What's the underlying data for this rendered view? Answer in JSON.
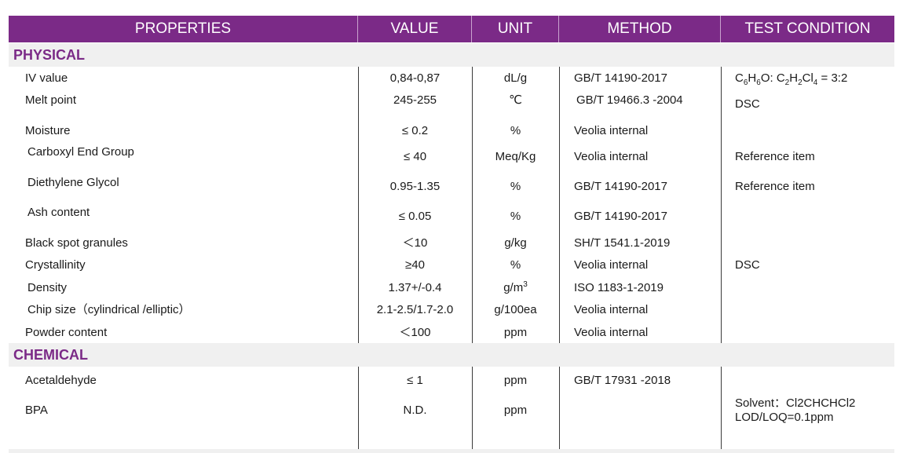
{
  "header": {
    "properties": "PROPERTIES",
    "value": "VALUE",
    "unit": "UNIT",
    "method": "METHOD",
    "test_condition": "TEST CONDITION"
  },
  "sections": {
    "physical": "PHYSICAL",
    "chemical": "CHEMICAL"
  },
  "rows": [
    {
      "property": "IV value",
      "value": "0,84-0,87",
      "unit": "dL/g",
      "method": "GB/T 14190-2017",
      "condition": "C6H6O: C2H2Cl4 = 3:2"
    },
    {
      "property": "Melt point",
      "value": "245-255",
      "unit": "℃",
      "method": "GB/T 19466.3 -2004",
      "condition": "DSC"
    },
    {
      "property": "Moisture",
      "value": "≤ 0.2",
      "unit": "%",
      "method": "Veolia internal",
      "condition": ""
    },
    {
      "property": "Carboxyl End Group",
      "value": "≤ 40",
      "unit": "Meq/Kg",
      "method": "Veolia internal",
      "condition": "Reference item"
    },
    {
      "property": "Diethylene Glycol",
      "value": "0.95-1.35",
      "unit": "%",
      "method": "GB/T 14190-2017",
      "condition": "Reference item"
    },
    {
      "property": "Ash content",
      "value": "≤ 0.05",
      "unit": "%",
      "method": "GB/T 14190-2017",
      "condition": ""
    },
    {
      "property": "Black spot granules",
      "value": "＜10",
      "unit": "g/kg",
      "method": "SH/T 1541.1-2019",
      "condition": ""
    },
    {
      "property": "Crystallinity",
      "value": "≥40",
      "unit": "%",
      "method": "Veolia internal",
      "condition": "DSC"
    },
    {
      "property": "Density",
      "value": "1.37+/-0.4",
      "unit": "g/m3",
      "method": "ISO 1183-1-2019",
      "condition": ""
    },
    {
      "property": "Chip size（cylindrical /elliptic）",
      "value": "2.1-2.5/1.7-2.0",
      "unit": "g/100ea",
      "method": "Veolia internal",
      "condition": ""
    },
    {
      "property": "Powder content",
      "value": "＜100",
      "unit": "ppm",
      "method": "Veolia internal",
      "condition": ""
    },
    {
      "property": "Acetaldehyde",
      "value": "≤ 1",
      "unit": "ppm",
      "method": "GB/T 17931 -2018",
      "condition": ""
    },
    {
      "property": "BPA",
      "value": "N.D.",
      "unit": "ppm",
      "method": "",
      "condition": "Solvent：Cl2CHCHCl2"
    }
  ],
  "bpa_condition_line2": "LOD/LOQ=0.1ppm",
  "colors": {
    "header_bg": "#7b2a87",
    "section_bg": "#f0f0f0",
    "section_text": "#7b2a87"
  }
}
